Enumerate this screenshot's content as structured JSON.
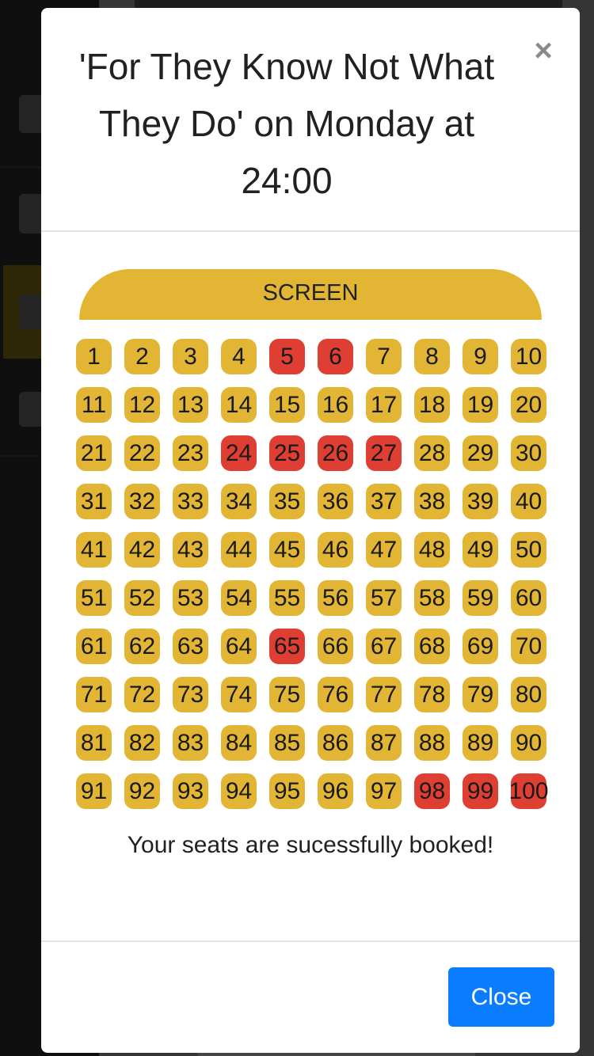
{
  "modal": {
    "title": "'For They Know Not What They Do' on Monday at 24:00",
    "close_icon": "×",
    "screen_label": "SCREEN",
    "status_message": "Your seats are sucessfully booked!",
    "close_button_label": "Close"
  },
  "seats": {
    "labels": [
      "1",
      "2",
      "3",
      "4",
      "5",
      "6",
      "7",
      "8",
      "9",
      "10",
      "11",
      "12",
      "13",
      "14",
      "15",
      "16",
      "17",
      "18",
      "19",
      "20",
      "21",
      "22",
      "23",
      "24",
      "25",
      "26",
      "27",
      "28",
      "29",
      "30",
      "31",
      "32",
      "33",
      "34",
      "35",
      "36",
      "37",
      "38",
      "39",
      "40",
      "41",
      "42",
      "43",
      "44",
      "45",
      "46",
      "47",
      "48",
      "49",
      "50",
      "51",
      "52",
      "53",
      "54",
      "55",
      "56",
      "57",
      "58",
      "59",
      "60",
      "61",
      "62",
      "63",
      "64",
      "65",
      "66",
      "67",
      "68",
      "69",
      "70",
      "71",
      "72",
      "73",
      "74",
      "75",
      "76",
      "77",
      "78",
      "79",
      "80",
      "81",
      "82",
      "83",
      "84",
      "85",
      "86",
      "87",
      "88",
      "89",
      "90",
      "91",
      "92",
      "93",
      "94",
      "95",
      "96",
      "97",
      "98",
      "99",
      "100"
    ],
    "booked": [
      "5",
      "6",
      "24",
      "25",
      "26",
      "27",
      "65",
      "98",
      "99",
      "100"
    ]
  },
  "colors": {
    "available": "#e2b634",
    "booked": "#df3e32",
    "primary": "#0a7cff"
  },
  "background_icons": [
    "home-icon",
    "ticket-icon",
    "camera-icon",
    "envelope-icon"
  ]
}
